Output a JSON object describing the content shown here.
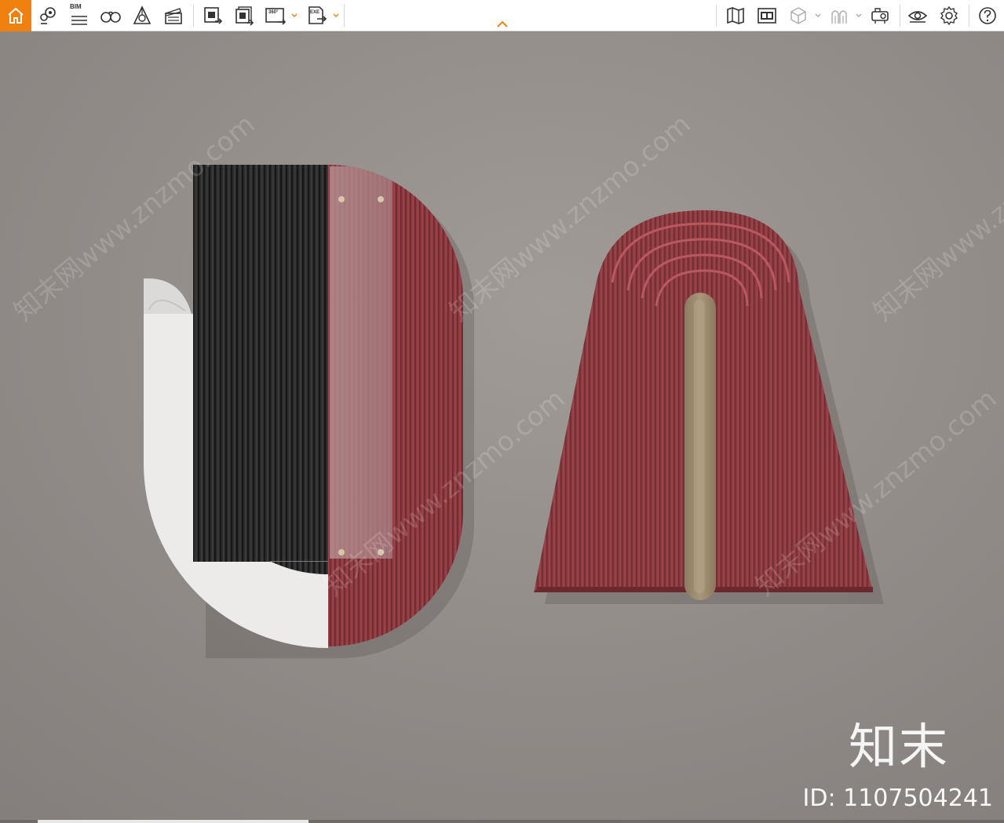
{
  "toolbar": {
    "left_tools": [
      {
        "icon": "home-icon"
      },
      {
        "icon": "location-pin-icon"
      },
      {
        "icon": "bim-icon",
        "label": "BIM"
      },
      {
        "icon": "binoculars-icon"
      },
      {
        "icon": "prism-icon"
      },
      {
        "icon": "clapperboard-icon"
      },
      {
        "icon": "export-image-icon"
      },
      {
        "icon": "export-multi-image-icon"
      },
      {
        "icon": "export-360-icon",
        "label": "360°"
      },
      {
        "icon": "export-exe-icon",
        "label": "EXE"
      }
    ],
    "right_tools": [
      {
        "icon": "map-icon"
      },
      {
        "icon": "layout-icon"
      },
      {
        "icon": "cube-icon"
      },
      {
        "icon": "arches-icon"
      },
      {
        "icon": "projector-icon"
      },
      {
        "icon": "eye-icon"
      },
      {
        "icon": "gear-icon"
      },
      {
        "icon": "help-icon"
      }
    ],
    "accent_color": "#f0810e"
  },
  "viewport": {
    "brand": "知末",
    "model_id": "ID: 1107504241",
    "watermark": "知末网www.znzmo.com",
    "wall_color": "#8f8a87",
    "panel_colors": {
      "black": "#2a2a2b",
      "red": "#8e3a3f",
      "white": "#ecebea",
      "tan": "#a08e72"
    }
  }
}
